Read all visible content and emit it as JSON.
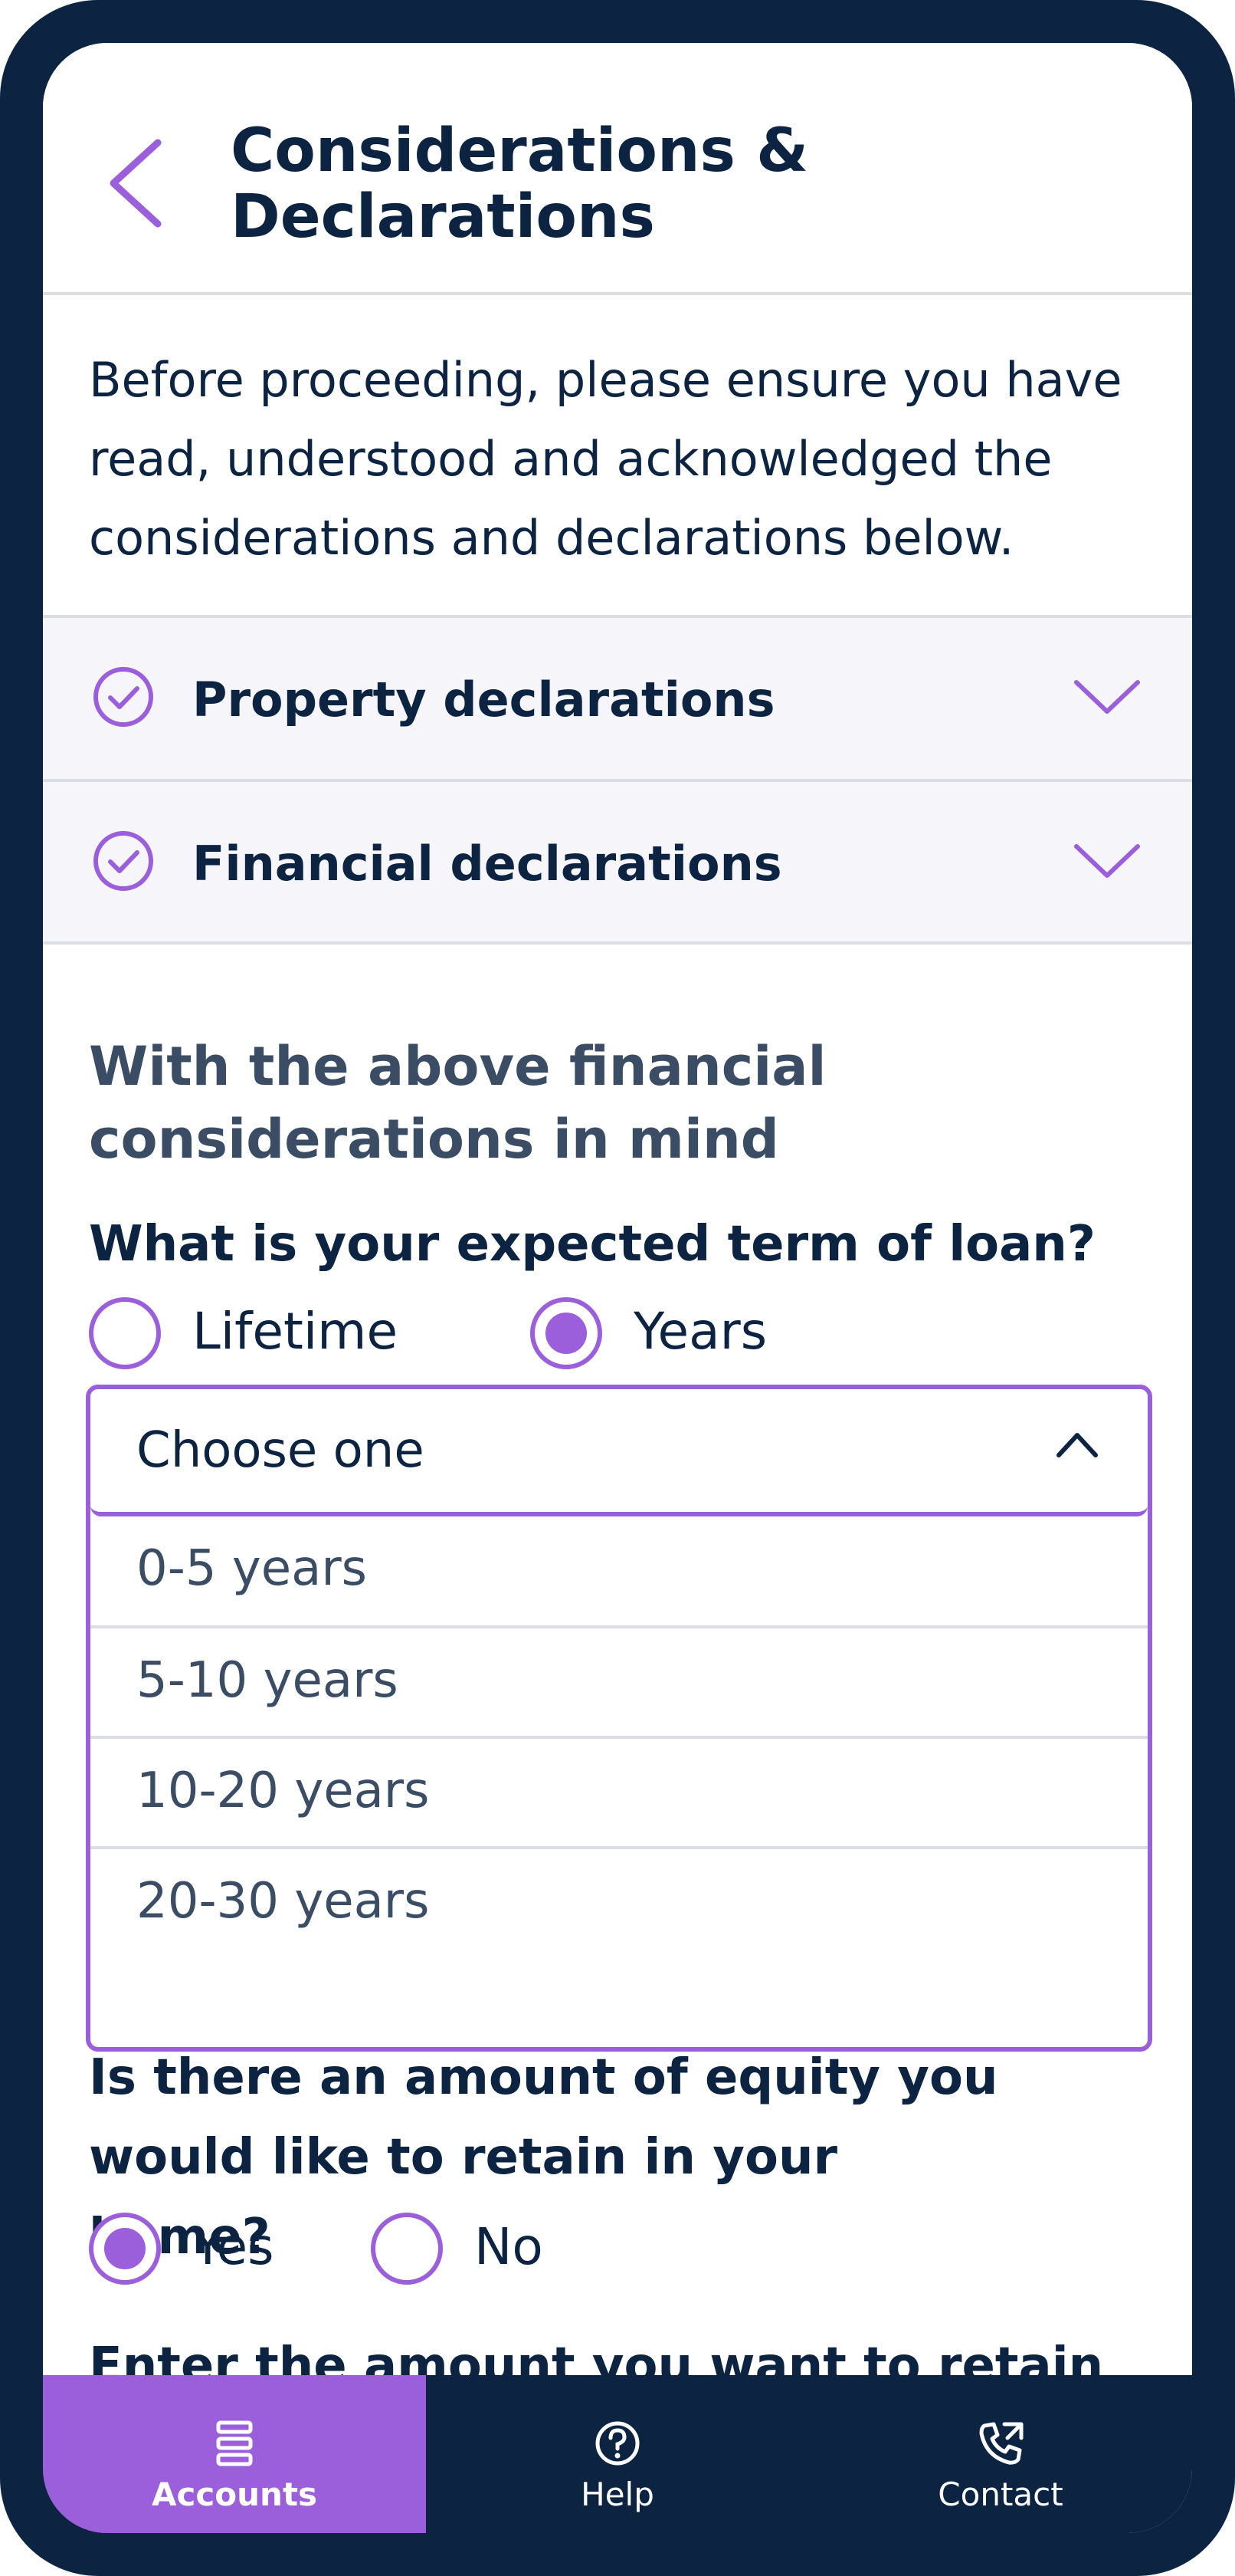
{
  "header": {
    "title_line1": "Considerations &",
    "title_line2": "Declarations"
  },
  "intro": {
    "text": "Before proceeding, please ensure you have read, understood and acknowledged the considerations and declarations below."
  },
  "accordions": [
    {
      "label": "Property declarations",
      "completed": true
    },
    {
      "label": "Financial declarations",
      "completed": true
    }
  ],
  "section": {
    "heading": "With the above financial considerations in mind"
  },
  "term_question": {
    "label": "What is your expected term of loan?",
    "options": [
      {
        "label": "Lifetime",
        "selected": false
      },
      {
        "label": "Years",
        "selected": true
      }
    ]
  },
  "term_select": {
    "value": "Choose one",
    "expanded": true,
    "options": [
      "0-5 years",
      "5-10 years",
      "10-20 years",
      "20-30 years"
    ]
  },
  "equity_question": {
    "label": "Is there an amount of equity you would like to retain in your home?",
    "options": [
      {
        "label": "Yes",
        "selected": true
      },
      {
        "label": "No",
        "selected": false
      }
    ]
  },
  "retain_amount": {
    "label": "Enter the amount you want to retain"
  },
  "bottom_nav": {
    "items": [
      {
        "label": "Accounts",
        "icon": "accounts-icon",
        "active": true
      },
      {
        "label": "Help",
        "icon": "help-icon",
        "active": false
      },
      {
        "label": "Contact",
        "icon": "phone-icon",
        "active": false
      }
    ]
  },
  "colors": {
    "navy": "#0c2442",
    "accent": "#9b5fdc",
    "accordion_bg": "#f6f6fa",
    "muted_text": "#3b4d65"
  }
}
